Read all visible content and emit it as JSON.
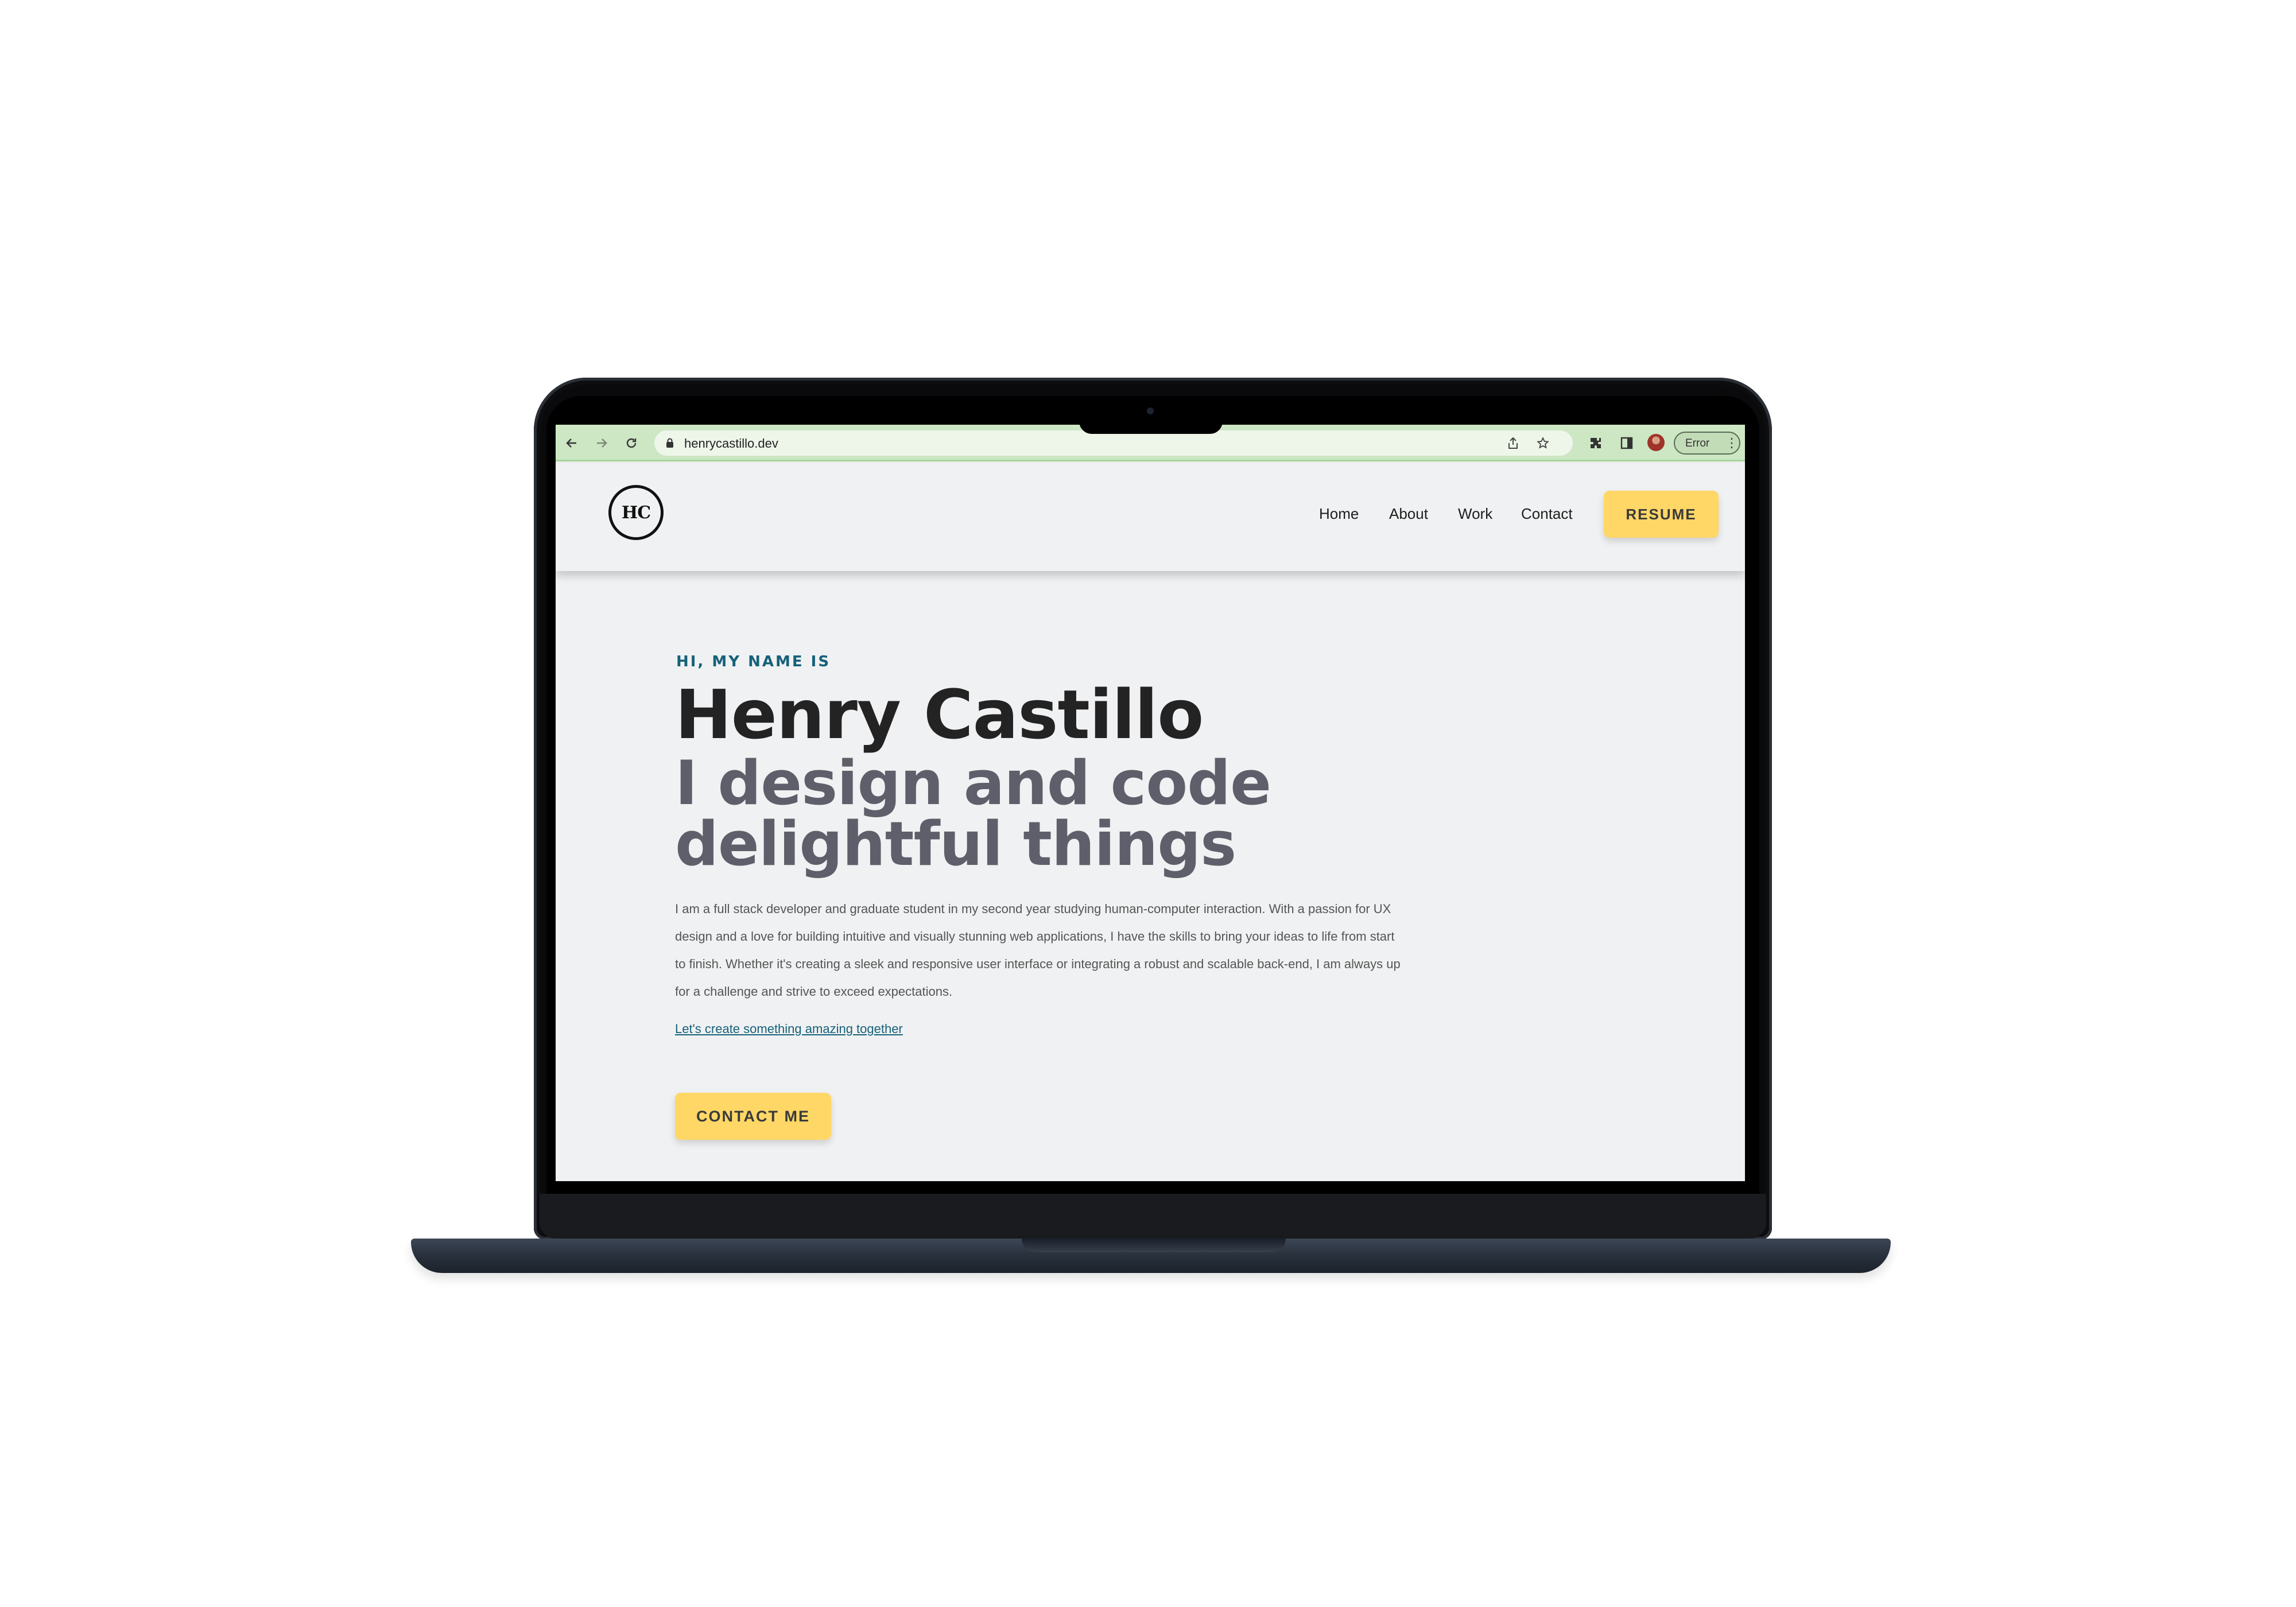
{
  "browser": {
    "back_icon": "arrow-left-icon",
    "forward_icon": "arrow-right-icon",
    "reload_icon": "reload-icon",
    "url": "henrycastillo.dev",
    "share_icon": "share-icon",
    "bookmark_icon": "star-icon",
    "extensions_icon": "puzzle-icon",
    "sidepanel_icon": "side-panel-icon",
    "profile_status": "Error",
    "accent_color": "#cde7c4"
  },
  "header": {
    "logo": "HC",
    "nav": [
      {
        "label": "Home"
      },
      {
        "label": "About"
      },
      {
        "label": "Work"
      },
      {
        "label": "Contact"
      }
    ],
    "resume_label": "RESUME"
  },
  "hero": {
    "eyebrow": "HI, MY NAME IS",
    "name": "Henry Castillo",
    "tagline": "I design and code delightful things",
    "body": "I am a full stack developer and graduate student in my second year studying human-computer interaction. With a passion for UX design and a love for building intuitive and visually stunning web applications, I have the skills to bring your ideas to life from start to finish. Whether it's creating a sleek and responsive user interface or integrating a robust and scalable back-end, I am always up for a challenge and strive to exceed expectations.",
    "link_text": "Let's create something amazing together",
    "cta_label": "CONTACT ME"
  },
  "colors": {
    "button_yellow": "#ffd766",
    "link_teal": "#16617a",
    "page_background": "#f0f1f2"
  }
}
